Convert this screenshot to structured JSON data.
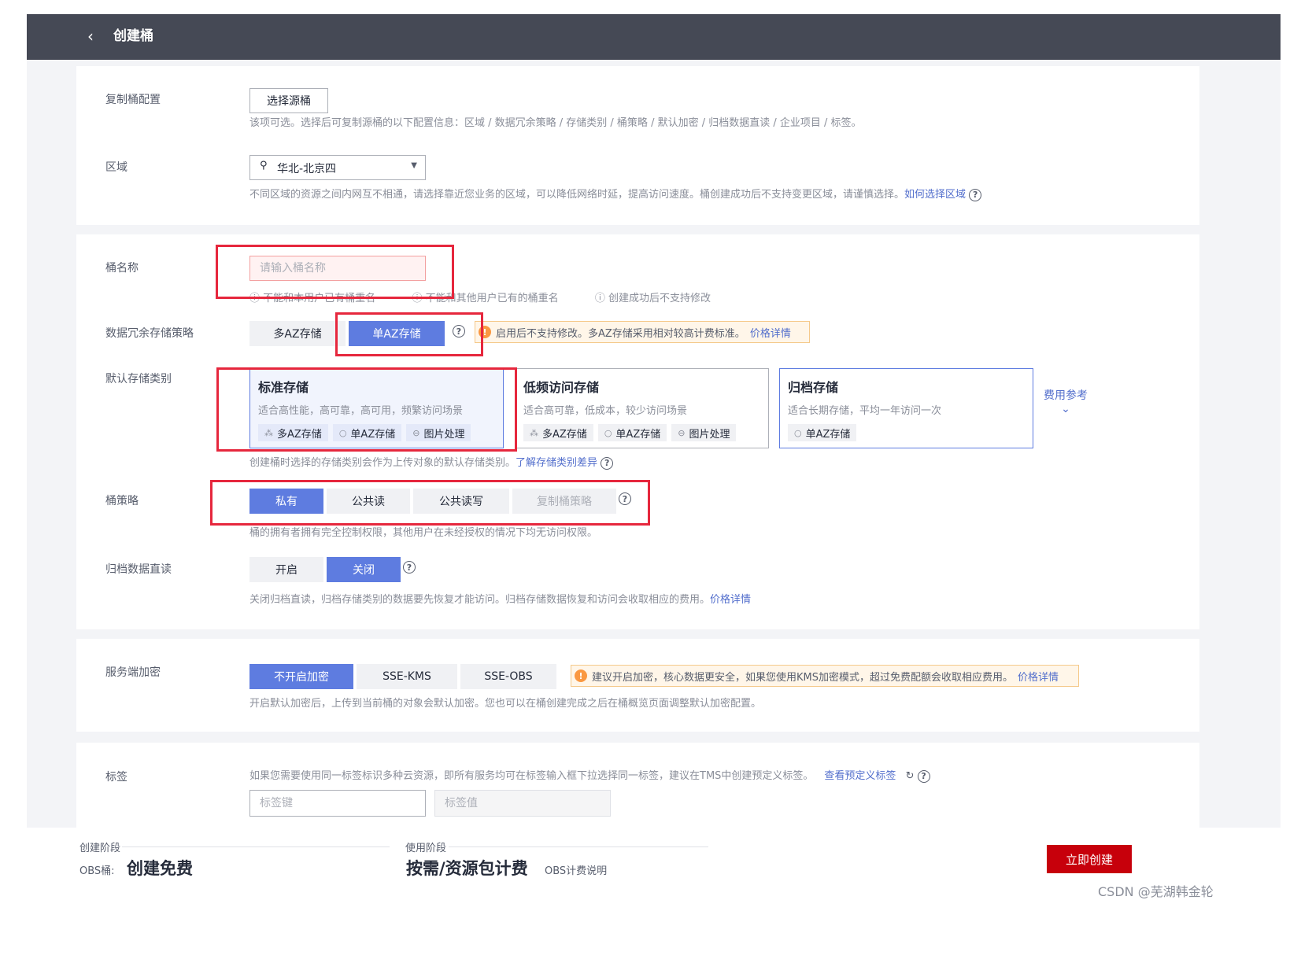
{
  "header": {
    "title": "创建桶"
  },
  "replicate": {
    "label": "复制桶配置",
    "button": "选择源桶",
    "hint": "该项可选。选择后可复制源桶的以下配置信息：区域 / 数据冗余策略 / 存储类别 / 桶策略 / 默认加密 / 归档数据直读 / 企业项目 / 标签。"
  },
  "region": {
    "label": "区域",
    "value": "华北-北京四",
    "hint": "不同区域的资源之间内网互不相通，请选择靠近您业务的区域，可以降低网络时延，提高访问速度。桶创建成功后不支持变更区域，请谨慎选择。",
    "link": "如何选择区域"
  },
  "bucket_name": {
    "label": "桶名称",
    "placeholder": "请输入桶名称",
    "rules": [
      "不能和本用户已有桶重名",
      "不能和其他用户已有的桶重名",
      "创建成功后不支持修改"
    ]
  },
  "redundancy": {
    "label": "数据冗余存储策略",
    "options": [
      "多AZ存储",
      "单AZ存储"
    ],
    "selected": "单AZ存储",
    "warning": "启用后不支持修改。多AZ存储采用相对较高计费标准。",
    "warning_link": "价格详情"
  },
  "storage_class": {
    "label": "默认存储类别",
    "types": [
      {
        "title": "标准存储",
        "desc": "适合高性能，高可靠，高可用，频繁访问场景",
        "tags": [
          "多AZ存储",
          "单AZ存储",
          "图片处理"
        ]
      },
      {
        "title": "低频访问存储",
        "desc": "适合高可靠，低成本，较少访问场景",
        "tags": [
          "多AZ存储",
          "单AZ存储",
          "图片处理"
        ]
      },
      {
        "title": "归档存储",
        "desc": "适合长期存储，平均一年访问一次",
        "tags": [
          "单AZ存储"
        ]
      }
    ],
    "cost_ref": "费用参考",
    "hint": "创建桶时选择的存储类别会作为上传对象的默认存储类别。",
    "hint_link": "了解存储类别差异"
  },
  "policy": {
    "label": "桶策略",
    "options": [
      "私有",
      "公共读",
      "公共读写",
      "复制桶策略"
    ],
    "selected": "私有",
    "hint": "桶的拥有者拥有完全控制权限，其他用户在未经授权的情况下均无访问权限。"
  },
  "archive": {
    "label": "归档数据直读",
    "options": [
      "开启",
      "关闭"
    ],
    "selected": "关闭",
    "hint": "关闭归档直读，归档存储类别的数据要先恢复才能访问。归档存储数据恢复和访问会收取相应的费用。",
    "hint_link": "价格详情"
  },
  "encryption": {
    "label": "服务端加密",
    "options": [
      "不开启加密",
      "SSE-KMS",
      "SSE-OBS"
    ],
    "selected": "不开启加密",
    "warning": "建议开启加密，核心数据更安全，如果您使用KMS加密模式，超过免费配额会收取相应费用。",
    "warning_link": "价格详情",
    "hint": "开启默认加密后，上传到当前桶的对象会默认加密。您也可以在桶创建完成之后在桶概览页面调整默认加密配置。"
  },
  "tags": {
    "label": "标签",
    "hint": "如果您需要使用同一标签标识多种云资源，即所有服务均可在标签输入框下拉选择同一标签，建议在TMS中创建预定义标签。",
    "link": "查看预定义标签",
    "key_placeholder": "标签键",
    "value_placeholder": "标签值"
  },
  "footer": {
    "create_stage": "创建阶段",
    "obs_bucket": "OBS桶:",
    "create_free": "创建免费",
    "use_stage": "使用阶段",
    "pay_mode": "按需/资源包计费",
    "billing_link": "OBS计费说明",
    "create_button": "立即创建"
  },
  "watermark": "CSDN @芜湖韩金轮",
  "colors": {
    "primary": "#5e7ce0",
    "create": "#c7000b",
    "header": "#454955",
    "annotation": "#e6273d"
  }
}
